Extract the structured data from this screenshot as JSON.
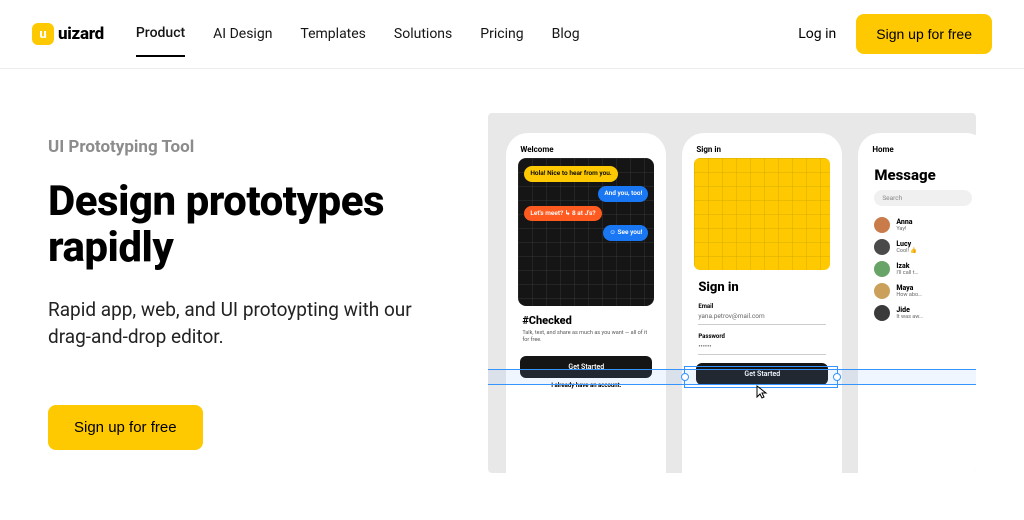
{
  "brand": "uizard",
  "nav": [
    "Product",
    "AI Design",
    "Templates",
    "Solutions",
    "Pricing",
    "Blog"
  ],
  "activeNav": 0,
  "login": "Log in",
  "signup": "Sign up for free",
  "eyebrow": "UI Prototyping Tool",
  "headline": "Design prototypes rapidly",
  "subhead": "Rapid app, web, and UI protoypting with our drag-and-drop editor.",
  "cta": "Sign up for free",
  "preview": {
    "welcome": {
      "label": "Welcome",
      "bubbles": [
        "Hola!\nNice to hear from you.",
        "And you, too!",
        "Let's meet?\n↳ 8 at J's?",
        "☺ See you!"
      ],
      "title": "#Checked",
      "desc": "Talk, text, and share as much as you want — all of it for free.",
      "btn": "Get Started",
      "link": "I already have an account."
    },
    "signin": {
      "label": "Sign in",
      "title": "Sign in",
      "emailLabel": "Email",
      "emailValue": "yana.petrov@mail.com",
      "passwordLabel": "Password",
      "passwordValue": "••••••",
      "btn": "Get Started"
    },
    "home": {
      "label": "Home",
      "title": "Message",
      "search": "Search",
      "contacts": [
        {
          "name": "Anna",
          "sub": "Yay!",
          "color": "#c97b4a"
        },
        {
          "name": "Lucy",
          "sub": "Cool! 👍",
          "color": "#4a4a4a"
        },
        {
          "name": "Izak",
          "sub": "I'll call t…",
          "color": "#68a368"
        },
        {
          "name": "Maya",
          "sub": "How abo…",
          "color": "#caa05a"
        },
        {
          "name": "Jide",
          "sub": "It was aw…",
          "color": "#3a3a3a"
        }
      ]
    }
  }
}
